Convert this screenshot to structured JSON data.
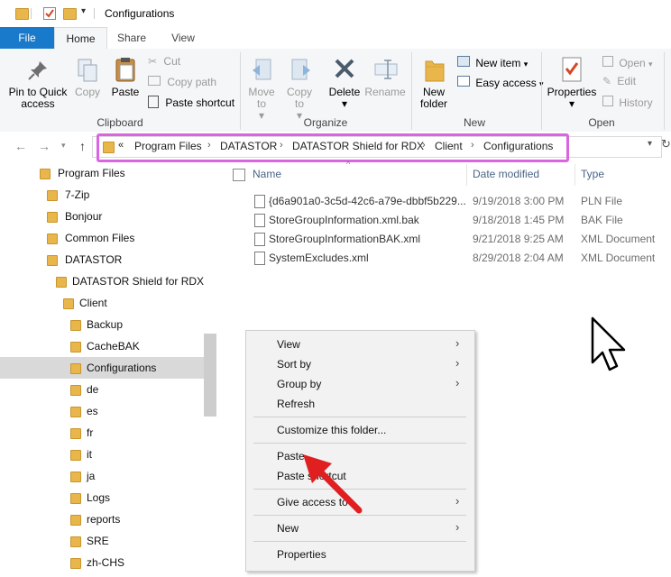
{
  "window": {
    "title": "Configurations"
  },
  "ribbon_tabs": [
    "File",
    "Home",
    "Share",
    "View"
  ],
  "ribbon": {
    "clipboard": {
      "label": "Clipboard",
      "pin": "Pin to Quick access",
      "copy": "Copy",
      "paste": "Paste",
      "cut": "Cut",
      "copy_path": "Copy path",
      "paste_shortcut": "Paste shortcut"
    },
    "organize": {
      "label": "Organize",
      "move_to": "Move to",
      "copy_to": "Copy to",
      "delete": "Delete",
      "rename": "Rename"
    },
    "new": {
      "label": "New",
      "new_folder": "New folder",
      "new_item": "New item",
      "easy_access": "Easy access"
    },
    "open": {
      "label": "Open",
      "properties": "Properties",
      "open": "Open",
      "edit": "Edit",
      "history": "History"
    }
  },
  "address": {
    "overflow": "«",
    "crumbs": [
      "Program Files",
      "DATASTOR",
      "DATASTOR Shield for RDX",
      "Client",
      "Configurations"
    ]
  },
  "nav_tree": [
    {
      "label": "Program Files"
    },
    {
      "label": "7-Zip"
    },
    {
      "label": "Bonjour"
    },
    {
      "label": "Common Files"
    },
    {
      "label": "DATASTOR"
    },
    {
      "label": "DATASTOR Shield for RDX"
    },
    {
      "label": "Client"
    },
    {
      "label": "Backup"
    },
    {
      "label": "CacheBAK"
    },
    {
      "label": "Configurations",
      "selected": true
    },
    {
      "label": "de"
    },
    {
      "label": "es"
    },
    {
      "label": "fr"
    },
    {
      "label": "it"
    },
    {
      "label": "ja"
    },
    {
      "label": "Logs"
    },
    {
      "label": "reports"
    },
    {
      "label": "SRE"
    },
    {
      "label": "zh-CHS"
    }
  ],
  "columns": {
    "name": "Name",
    "date": "Date modified",
    "type": "Type"
  },
  "files": [
    {
      "name": "{d6a901a0-3c5d-42c6-a79e-dbbf5b229...",
      "date": "9/19/2018 3:00 PM",
      "type": "PLN File"
    },
    {
      "name": "StoreGroupInformation.xml.bak",
      "date": "9/18/2018 1:45 PM",
      "type": "BAK File"
    },
    {
      "name": "StoreGroupInformationBAK.xml",
      "date": "9/21/2018 9:25 AM",
      "type": "XML Document"
    },
    {
      "name": "SystemExcludes.xml",
      "date": "8/29/2018 2:04 AM",
      "type": "XML Document"
    }
  ],
  "context_menu": {
    "view": "View",
    "sort_by": "Sort by",
    "group_by": "Group by",
    "refresh": "Refresh",
    "customize": "Customize this folder...",
    "paste": "Paste",
    "paste_shortcut": "Paste shortcut",
    "give_access": "Give access to",
    "new": "New",
    "properties": "Properties"
  },
  "colors": {
    "file_tab": "#1979ca",
    "highlight_box": "#d966e0",
    "arrow": "#e02020",
    "folder": "#e8b64b"
  }
}
